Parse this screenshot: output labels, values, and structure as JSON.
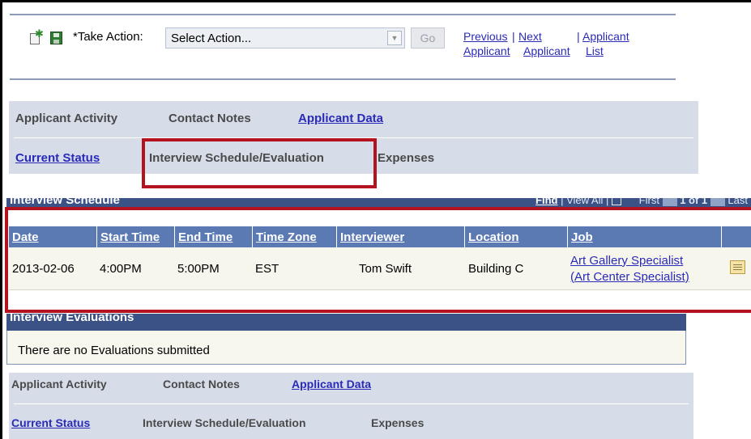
{
  "toolbar": {
    "take_action_label": "*Take Action:",
    "select_value": "Select Action...",
    "go_label": "Go",
    "prev_line1": "Previous",
    "prev_line2": "Applicant",
    "next_line1": "Next",
    "next_line2": "Applicant",
    "list_line1": "Applicant",
    "list_line2": "List"
  },
  "tabs_top": {
    "row1": [
      "Applicant Activity",
      "Contact Notes",
      "Applicant Data"
    ],
    "row2": [
      "Current Status",
      "Interview Schedule/Evaluation",
      "Expenses"
    ]
  },
  "interview_schedule": {
    "title": "Interview Schedule",
    "find": "Find",
    "view_all": "View All",
    "first": "First",
    "count": "1 of 1",
    "last": "Last",
    "columns": [
      "Date",
      "Start Time",
      "End Time",
      "Time Zone",
      "Interviewer",
      "Location",
      "Job"
    ],
    "rows": [
      {
        "date": "2013-02-06",
        "start_time": "4:00PM",
        "end_time": "5:00PM",
        "time_zone": "EST",
        "interviewer": "Tom Swift",
        "location": "Building C",
        "job_line1": "Art Gallery Specialist",
        "job_line2": "(Art Center Specialist)"
      }
    ]
  },
  "interview_evaluations": {
    "title": "Interview Evaluations",
    "message": "There are no Evaluations submitted"
  },
  "tabs_bottom": {
    "row1": [
      "Applicant Activity",
      "Contact Notes",
      "Applicant Data"
    ],
    "row2": [
      "Current Status",
      "Interview Schedule/Evaluation",
      "Expenses"
    ]
  },
  "colors": {
    "grid_header": "#5b7ab4",
    "grid_title": "#3b5287",
    "tab_panel": "#d6dde9",
    "highlight": "#b3121f",
    "link": "#2a2ab8"
  }
}
